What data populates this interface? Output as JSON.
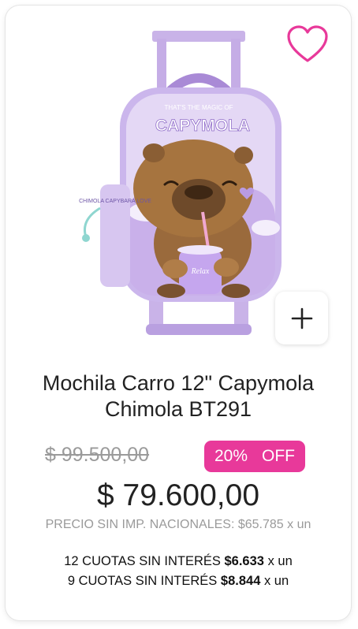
{
  "product": {
    "title_line1": "Mochila Carro 12\" Capymola",
    "title_line2": "Chimola BT291",
    "image_alt": "Mochila carro capybara violeta",
    "artwork_text": {
      "bag_top": "THAT'S THE MAGIC OF",
      "bag_logo": "CAPYMOLA",
      "cup": "Relax",
      "pouch": "CHIMOLA CAPYBARA LOVE"
    }
  },
  "pricing": {
    "old_price": "$ 99.500,00",
    "discount_pct": "20%",
    "discount_label": "OFF",
    "price": "$ 79.600,00",
    "net_price": "PRECIO SIN IMP. NACIONALES: $65.785 x un"
  },
  "installments": [
    {
      "label": "12 CUOTAS SIN INTERÉS",
      "amount": "$6.633",
      "suffix": "x un"
    },
    {
      "label": "9 CUOTAS SIN INTERÉS",
      "amount": "$8.844",
      "suffix": "x un"
    }
  ],
  "icons": {
    "wishlist": "heart-outline-icon",
    "add": "plus-icon"
  },
  "colors": {
    "accent": "#e8399a",
    "bag": "#c9b3e8",
    "bear": "#9a6a3c"
  }
}
